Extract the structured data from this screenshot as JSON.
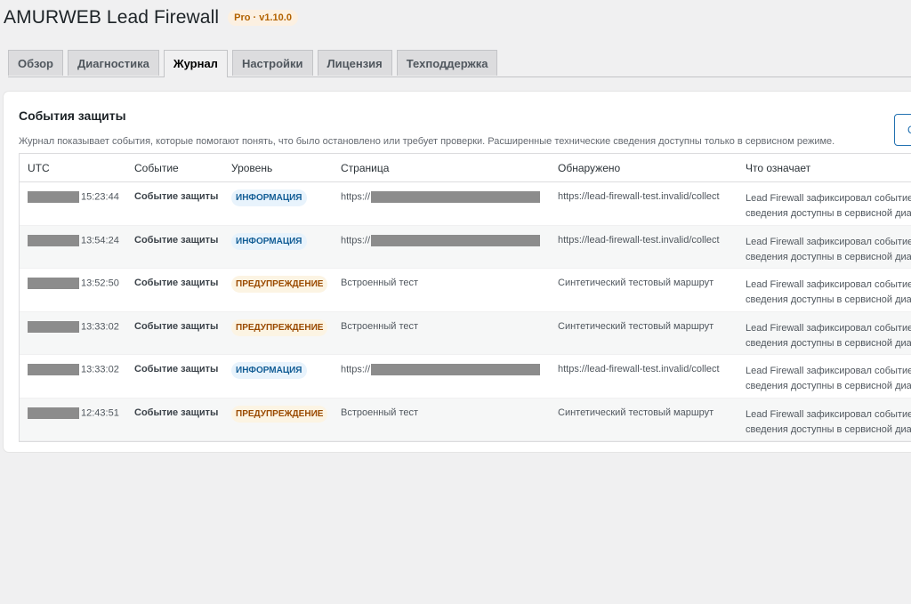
{
  "app": {
    "title": "AMURWEB Lead Firewall",
    "badge": "Pro · v1.10.0"
  },
  "tabs": [
    {
      "label": "Обзор",
      "active": false
    },
    {
      "label": "Диагностика",
      "active": false
    },
    {
      "label": "Журнал",
      "active": true
    },
    {
      "label": "Настройки",
      "active": false
    },
    {
      "label": "Лицензия",
      "active": false
    },
    {
      "label": "Техподдержка",
      "active": false
    }
  ],
  "panel": {
    "title": "События защиты",
    "description": "Журнал показывает события, которые помогают понять, что было остановлено или требует проверки. Расширенные технические сведения доступны только в сервисном режиме.",
    "corner_button_label": "С"
  },
  "table": {
    "headers": [
      "UTC",
      "Событие",
      "Уровень",
      "Страница",
      "Обнаружено",
      "Что означает"
    ],
    "rows": [
      {
        "time": "15:23:44",
        "event": "Событие защиты",
        "level": "ИНФОРМАЦИЯ",
        "level_kind": "info",
        "page": "https://",
        "page_redacted": true,
        "found": "https://lead-firewall-test.invalid/collect",
        "meaning1": "Lead Firewall зафиксировал событие",
        "meaning2": "сведения доступны в сервисной диа"
      },
      {
        "time": "13:54:24",
        "event": "Событие защиты",
        "level": "ИНФОРМАЦИЯ",
        "level_kind": "info",
        "page": "https://",
        "page_redacted": true,
        "found": "https://lead-firewall-test.invalid/collect",
        "meaning1": "Lead Firewall зафиксировал событие",
        "meaning2": "сведения доступны в сервисной диа"
      },
      {
        "time": "13:52:50",
        "event": "Событие защиты",
        "level": "ПРЕДУПРЕЖДЕНИЕ",
        "level_kind": "warn",
        "page": "Встроенный тест",
        "page_redacted": false,
        "found": "Синтетический тестовый маршрут",
        "meaning1": "Lead Firewall зафиксировал событие",
        "meaning2": "сведения доступны в сервисной диа"
      },
      {
        "time": "13:33:02",
        "event": "Событие защиты",
        "level": "ПРЕДУПРЕЖДЕНИЕ",
        "level_kind": "warn",
        "page": "Встроенный тест",
        "page_redacted": false,
        "found": "Синтетический тестовый маршрут",
        "meaning1": "Lead Firewall зафиксировал событие",
        "meaning2": "сведения доступны в сервисной диа"
      },
      {
        "time": "13:33:02",
        "event": "Событие защиты",
        "level": "ИНФОРМАЦИЯ",
        "level_kind": "info",
        "page": "https://",
        "page_redacted": true,
        "found": "https://lead-firewall-test.invalid/collect",
        "meaning1": "Lead Firewall зафиксировал событие",
        "meaning2": "сведения доступны в сервисной диа"
      },
      {
        "time": "12:43:51",
        "event": "Событие защиты",
        "level": "ПРЕДУПРЕЖДЕНИЕ",
        "level_kind": "warn",
        "page": "Встроенный тест",
        "page_redacted": false,
        "found": "Синтетический тестовый маршрут",
        "meaning1": "Lead Firewall зафиксировал событие",
        "meaning2": "сведения доступны в сервисной диа"
      }
    ]
  }
}
